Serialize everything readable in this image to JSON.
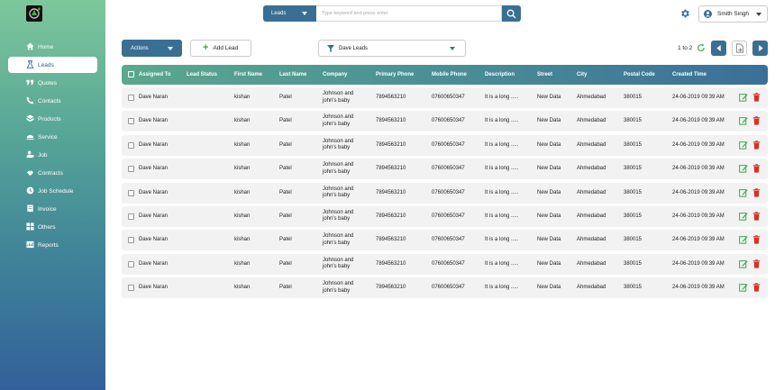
{
  "sidebar": {
    "items": [
      {
        "label": "Home",
        "icon": "home-icon"
      },
      {
        "label": "Leads",
        "icon": "leads-icon",
        "active": true
      },
      {
        "label": "Quotes",
        "icon": "quotes-icon"
      },
      {
        "label": "Contacts",
        "icon": "phone-icon"
      },
      {
        "label": "Products",
        "icon": "products-icon"
      },
      {
        "label": "Service",
        "icon": "service-icon"
      },
      {
        "label": "Job",
        "icon": "job-icon"
      },
      {
        "label": "Contracts",
        "icon": "contracts-icon"
      },
      {
        "label": "Job Schedule",
        "icon": "job-schedule-icon"
      },
      {
        "label": "Invoice",
        "icon": "invoice-icon"
      },
      {
        "label": "Others",
        "icon": "others-icon"
      },
      {
        "label": "Reports",
        "icon": "reports-icon"
      }
    ]
  },
  "search": {
    "module": "Leads",
    "placeholder": "Type keyword and press enter"
  },
  "user": {
    "name": "Smith Singh"
  },
  "toolbar": {
    "actions_label": "Actions",
    "add_label": "Add Lead",
    "filter_value": "Dave Leads",
    "pager_text": "1 to 2"
  },
  "table": {
    "columns": {
      "assigned": "Assigned To",
      "status": "Lead Status",
      "first": "First Name",
      "last": "Last Name",
      "company": "Company",
      "primary": "Primary Phone",
      "mobile": "Mobile Phone",
      "desc": "Description",
      "street": "Street",
      "city": "City",
      "postal": "Postal Code",
      "created": "Created Time"
    },
    "rows": [
      {
        "assigned": "Dave Naran",
        "status": "",
        "first": "kishan",
        "last": "Patel",
        "company": "Johnson and john's baby",
        "primary": "7894563210",
        "mobile": "07600650347",
        "desc": "It is a long .....",
        "street": "New Data",
        "city": "Ahmedabad",
        "postal": "380015",
        "created": "24-06-2019 09:39 AM"
      },
      {
        "assigned": "Dave Naran",
        "status": "",
        "first": "kishan",
        "last": "Patel",
        "company": "Johnson and john's baby",
        "primary": "7894563210",
        "mobile": "07600650347",
        "desc": "It is a long .....",
        "street": "New Data",
        "city": "Ahmedabad",
        "postal": "380015",
        "created": "24-06-2019 09:39 AM"
      },
      {
        "assigned": "Dave Naran",
        "status": "",
        "first": "kishan",
        "last": "Patel",
        "company": "Johnson and john's baby",
        "primary": "7894563210",
        "mobile": "07600650347",
        "desc": "It is a long .....",
        "street": "New Data",
        "city": "Ahmedabad",
        "postal": "380015",
        "created": "24-06-2019 09:39 AM"
      },
      {
        "assigned": "Dave Naran",
        "status": "",
        "first": "kishan",
        "last": "Patel",
        "company": "Johnson and john's baby",
        "primary": "7894563210",
        "mobile": "07600650347",
        "desc": "It is a long .....",
        "street": "New Data",
        "city": "Ahmedabad",
        "postal": "380015",
        "created": "24-06-2019 09:39 AM"
      },
      {
        "assigned": "Dave Naran",
        "status": "",
        "first": "kishan",
        "last": "Patel",
        "company": "Johnson and john's baby",
        "primary": "7894563210",
        "mobile": "07600650347",
        "desc": "It is a long .....",
        "street": "New Data",
        "city": "Ahmedabad",
        "postal": "380015",
        "created": "24-06-2019 09:39 AM"
      },
      {
        "assigned": "Dave Naran",
        "status": "",
        "first": "kishan",
        "last": "Patel",
        "company": "Johnson and john's baby",
        "primary": "7894563210",
        "mobile": "07600650347",
        "desc": "It is a long .....",
        "street": "New Data",
        "city": "Ahmedabad",
        "postal": "380015",
        "created": "24-06-2019 09:39 AM"
      },
      {
        "assigned": "Dave Naran",
        "status": "",
        "first": "kishan",
        "last": "Patel",
        "company": "Johnson and john's baby",
        "primary": "7894563210",
        "mobile": "07600650347",
        "desc": "It is a long .....",
        "street": "New Data",
        "city": "Ahmedabad",
        "postal": "380015",
        "created": "24-06-2019 09:39 AM"
      },
      {
        "assigned": "Dave Naran",
        "status": "",
        "first": "kishan",
        "last": "Patel",
        "company": "Johnson and john's baby",
        "primary": "7894563210",
        "mobile": "07600650347",
        "desc": "It is a long .....",
        "street": "New Data",
        "city": "Ahmedabad",
        "postal": "380015",
        "created": "24-06-2019 09:39 AM"
      },
      {
        "assigned": "Dave Naran",
        "status": "",
        "first": "kishan",
        "last": "Patel",
        "company": "Johnson and john's baby",
        "primary": "7894563210",
        "mobile": "07600650347",
        "desc": "It is a long .....",
        "street": "New Data",
        "city": "Ahmedabad",
        "postal": "380015",
        "created": "24-06-2019 09:39 AM"
      }
    ]
  },
  "colors": {
    "primary": "#3a6f94",
    "sidebar_top": "#7dc79b",
    "sidebar_bottom": "#33609a",
    "edit": "#3aa853",
    "delete": "#d93025"
  }
}
